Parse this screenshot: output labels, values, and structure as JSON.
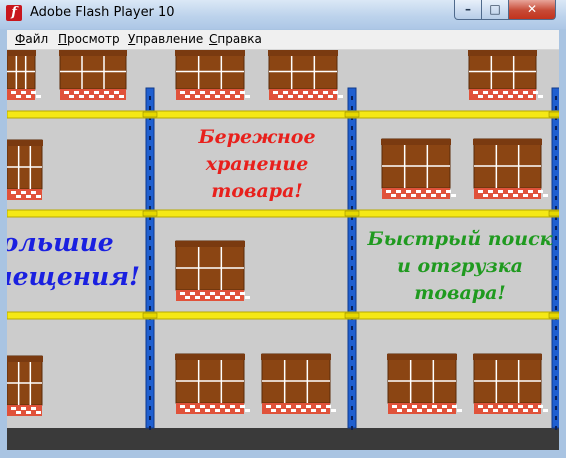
{
  "window": {
    "title": "Adobe Flash Player 10",
    "app_icon_glyph": "f",
    "controls": {
      "minimize_glyph": "–",
      "maximize_glyph": "□",
      "close_glyph": "✕"
    }
  },
  "menu": {
    "items": [
      {
        "label": "Файл",
        "underline": "Ф"
      },
      {
        "label": "Просмотр",
        "underline": "П"
      },
      {
        "label": "Управление",
        "underline": "У"
      },
      {
        "label": "Справка",
        "underline": "С"
      }
    ]
  },
  "signs": {
    "careful": {
      "lines": [
        "Бережное",
        "хранение",
        "товара!"
      ],
      "color": "#e8201c"
    },
    "premises": {
      "lines": [
        "Большие",
        "помещения!"
      ],
      "color": "#1a20e0"
    },
    "fast": {
      "lines": [
        "Быстрый поиск",
        "и отгрузка",
        "товара!"
      ],
      "color": "#1f9a1f"
    }
  },
  "colors": {
    "beam": "#f5e816",
    "post": "#1f5fd0",
    "box": "#8b4513",
    "pallet": "#e0523a",
    "floor": "#3a3a3a",
    "wall": "#cccccc"
  }
}
